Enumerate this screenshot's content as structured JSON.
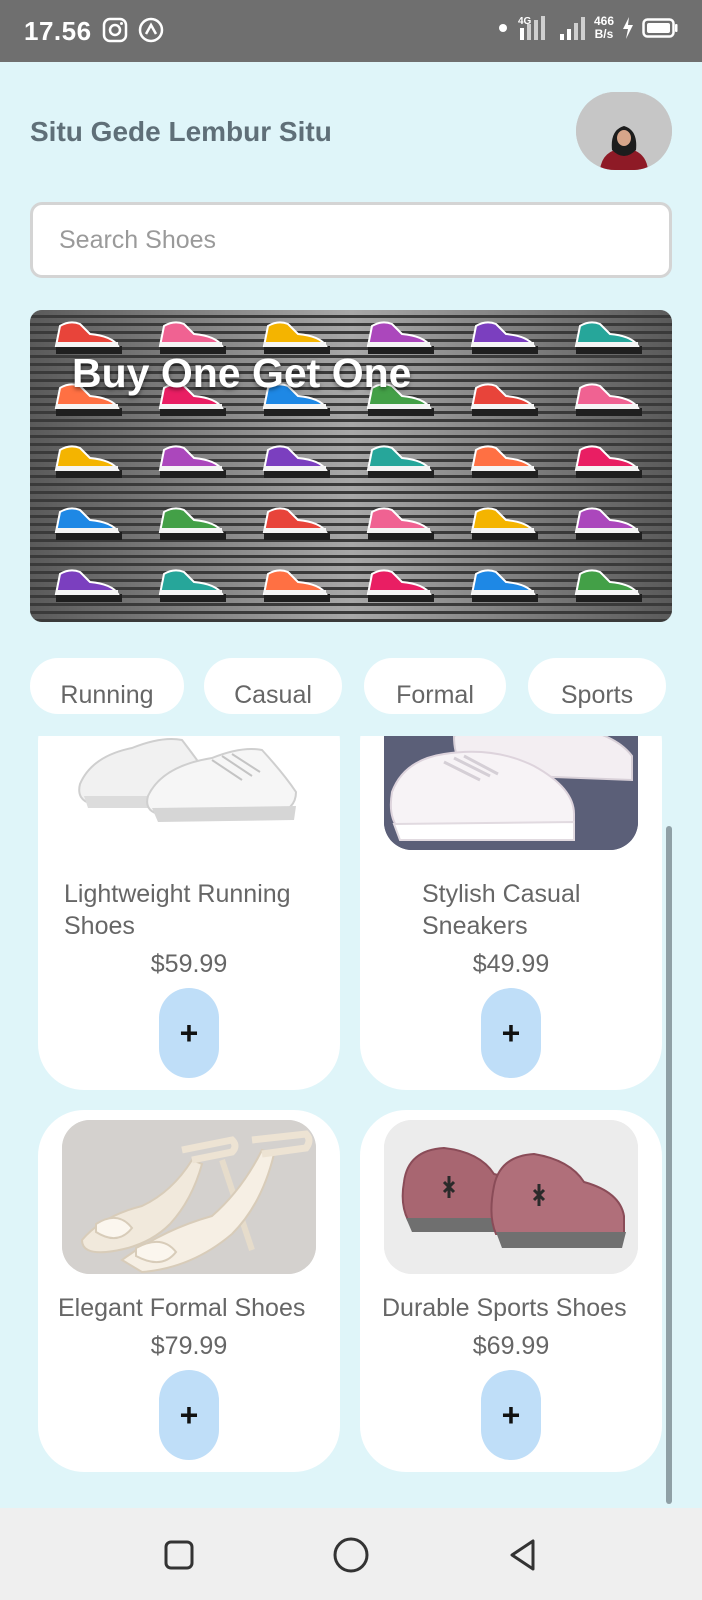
{
  "status_bar": {
    "time": "17.56",
    "net_speed_value": "466",
    "net_speed_unit": "B/s",
    "network_type": "4G"
  },
  "header": {
    "title": "Situ Gede Lembur Situ"
  },
  "search": {
    "placeholder": "Search Shoes",
    "value": ""
  },
  "banner": {
    "text": "Buy One Get One"
  },
  "categories": [
    "Running",
    "Casual",
    "Formal",
    "Sports"
  ],
  "products": [
    {
      "name": "Lightweight Running Shoes",
      "name_line1": "Lightweight Running",
      "name_line2": "Shoes",
      "price": "$59.99",
      "add_label": "+"
    },
    {
      "name": "Stylish Casual Sneakers",
      "name_line1": "Stylish Casual",
      "name_line2": "Sneakers",
      "price": "$49.99",
      "add_label": "+"
    },
    {
      "name": "Elegant Formal Shoes",
      "name_line1": "Elegant Formal Shoes",
      "name_line2": "",
      "price": "$79.99",
      "add_label": "+"
    },
    {
      "name": "Durable Sports Shoes",
      "name_line1": "Durable Sports Shoes",
      "name_line2": "",
      "price": "$69.99",
      "add_label": "+"
    }
  ],
  "icons": {
    "status_left": [
      "instagram-icon",
      "app-notification-icon"
    ],
    "status_right": [
      "dot-icon",
      "signal-icon",
      "signal-icon",
      "charging-icon",
      "battery-icon"
    ],
    "nav": [
      "recents-square-icon",
      "home-circle-icon",
      "back-triangle-icon"
    ]
  },
  "colors": {
    "background": "#dff5f9",
    "card": "#ffffff",
    "add_button": "#bfdef8",
    "status_bar": "#6f6f6f",
    "nav_bar": "#efefef",
    "text_muted": "#666666",
    "title": "#5f6f78"
  }
}
